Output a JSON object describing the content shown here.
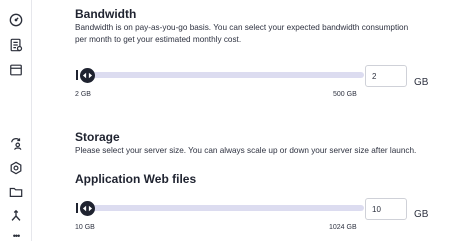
{
  "sidebar": {
    "icons": [
      "gauge-icon",
      "server-list-icon",
      "window-icon",
      "user-sync-icon",
      "settings-icon",
      "folder-icon",
      "branch-icon",
      "more-icon"
    ],
    "more_glyph": "•••"
  },
  "bandwidth": {
    "title": "Bandwidth",
    "description": "Bandwidth is on pay-as-you-go basis. You can select your expected bandwidth consumption per month to get your estimated monthly cost.",
    "value": "2",
    "unit": "GB",
    "min_label": "2 GB",
    "max_label": "500 GB",
    "level": 0
  },
  "storage": {
    "title": "Storage",
    "description": "Please select your server size. You can always scale up or down your server size after launch."
  },
  "app_files": {
    "title": "Application Web files",
    "value": "10",
    "unit": "GB",
    "min_label": "10 GB",
    "max_label": "1024 GB",
    "level": 0
  }
}
